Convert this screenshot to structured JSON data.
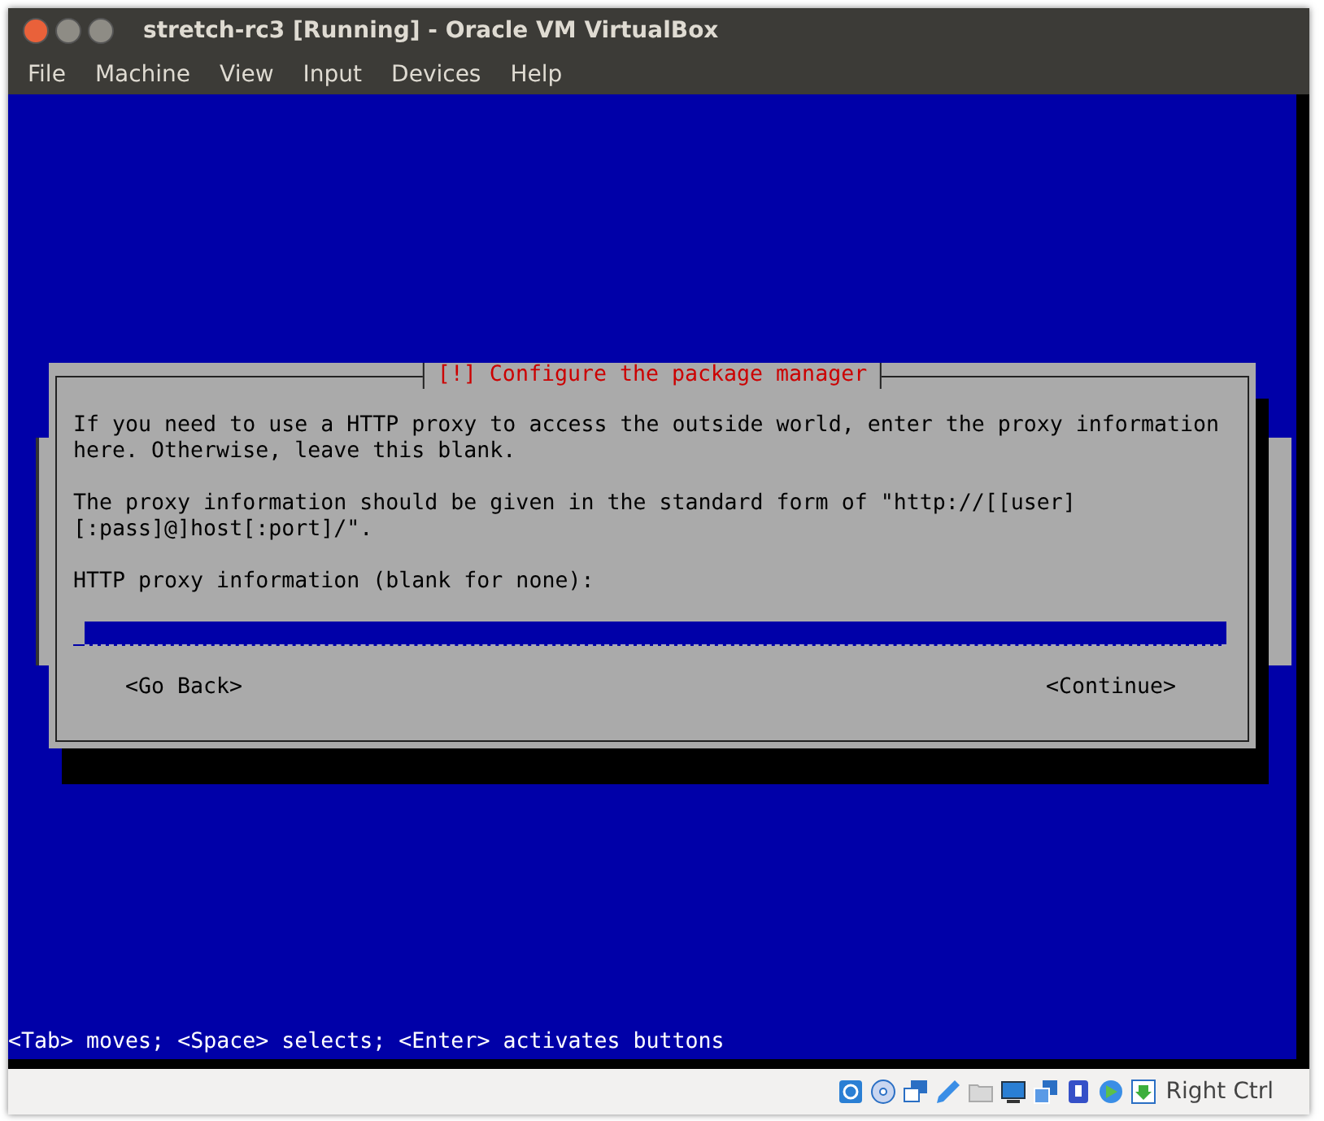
{
  "window": {
    "title": "stretch-rc3 [Running] - Oracle VM VirtualBox"
  },
  "menu": [
    "File",
    "Machine",
    "View",
    "Input",
    "Devices",
    "Help"
  ],
  "dialog": {
    "title": "[!] Configure the package manager",
    "paragraphs": [
      "If you need to use a HTTP proxy to access the outside world, enter the proxy information here. Otherwise, leave this blank.",
      "The proxy information should be given in the standard form of \"http://[[user][:pass]@]host[:port]/\"."
    ],
    "field_label": "HTTP proxy information (blank for none):",
    "buttons": [
      "<Go Back>",
      "<Continue>"
    ]
  },
  "help_line": "<Tab> moves; <Space> selects; <Enter> activates buttons",
  "status_bar": {
    "host_key": "Right Ctrl"
  }
}
